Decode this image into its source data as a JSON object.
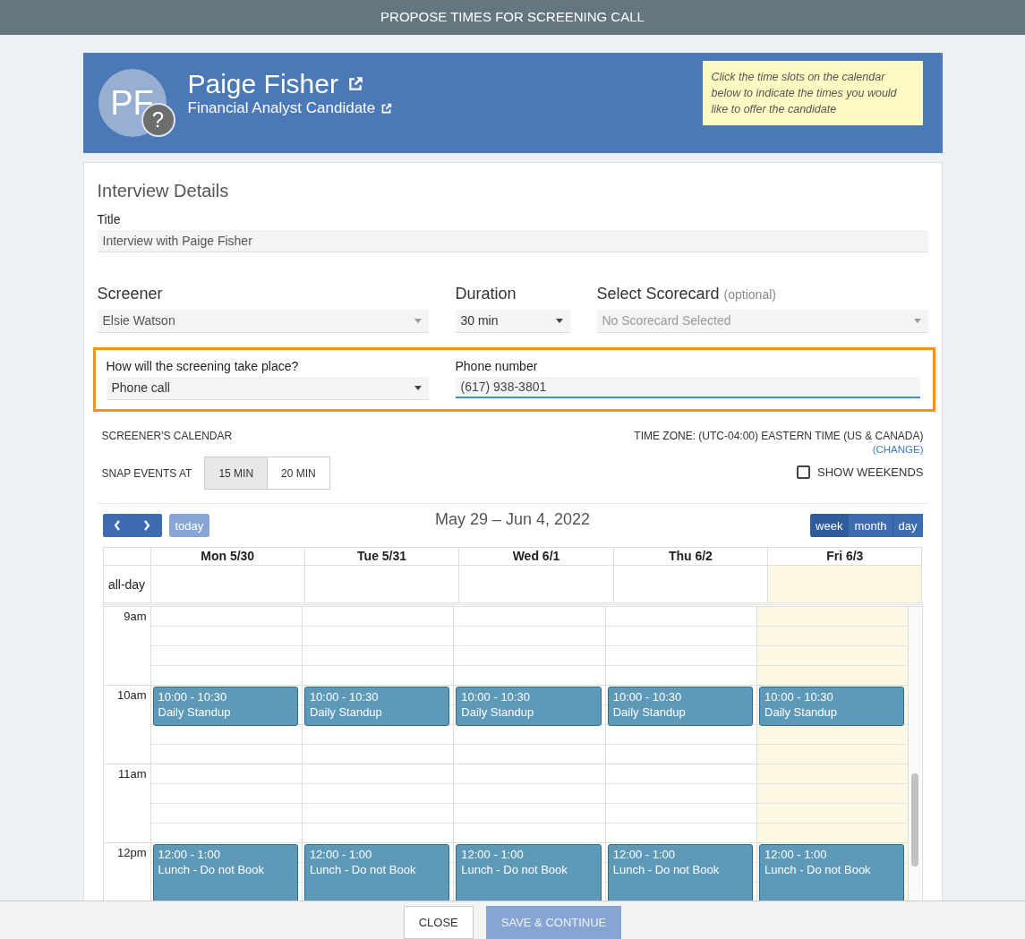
{
  "dialog": {
    "title": "PROPOSE TIMES FOR SCREENING CALL"
  },
  "candidate": {
    "initials": "PF",
    "badge": "?",
    "name": "Paige Fisher",
    "role": "Financial Analyst Candidate",
    "hint": "Click the time slots on the calendar below to indicate the times you would like to offer the candidate"
  },
  "details": {
    "heading": "Interview Details",
    "title_label": "Title",
    "title_value": "Interview with Paige Fisher",
    "screener": {
      "label": "Screener",
      "value": "Elsie Watson"
    },
    "duration": {
      "label": "Duration",
      "value": "30 min"
    },
    "scorecard": {
      "label": "Select Scorecard",
      "note": "(optional)",
      "placeholder": "No Scorecard Selected",
      "disabled": true
    },
    "method": {
      "label": "How will the screening take place?",
      "value": "Phone call"
    },
    "phone": {
      "label": "Phone number",
      "value": "(617) 938-3801"
    }
  },
  "calendar": {
    "label": "SCREENER'S CALENDAR",
    "timezone": "TIME ZONE: (UTC-04:00) EASTERN TIME (US & CANADA)",
    "change_link": "(CHANGE)",
    "snap_label": "SNAP EVENTS AT",
    "snap_options": [
      {
        "label": "15 MIN",
        "selected": true
      },
      {
        "label": "20 MIN",
        "selected": false
      }
    ],
    "show_weekends": {
      "label": "SHOW WEEKENDS",
      "checked": false
    },
    "range": "May 29 – Jun 4, 2022",
    "today_button": "today",
    "views": [
      {
        "label": "week",
        "selected": true
      },
      {
        "label": "month",
        "selected": false
      },
      {
        "label": "day",
        "selected": false
      }
    ],
    "all_day_label": "all-day",
    "days": [
      {
        "label": "Mon 5/30",
        "today": false
      },
      {
        "label": "Tue 5/31",
        "today": false
      },
      {
        "label": "Wed 6/1",
        "today": false
      },
      {
        "label": "Thu 6/2",
        "today": false
      },
      {
        "label": "Fri 6/3",
        "today": true
      }
    ],
    "hours": [
      {
        "label": "9am"
      },
      {
        "label": "10am",
        "events": [
          {
            "kind": "short",
            "time": "10:00 - 10:30",
            "title": "Daily Standup"
          },
          {
            "kind": "short",
            "time": "10:00 - 10:30",
            "title": "Daily Standup"
          },
          {
            "kind": "short",
            "time": "10:00 - 10:30",
            "title": "Daily Standup"
          },
          {
            "kind": "short",
            "time": "10:00 - 10:30",
            "title": "Daily Standup"
          },
          {
            "kind": "short",
            "time": "10:00 - 10:30",
            "title": "Daily Standup"
          }
        ]
      },
      {
        "label": "11am"
      },
      {
        "label": "12pm",
        "events": [
          {
            "kind": "long",
            "time": "12:00 - 1:00",
            "title": "Lunch - Do not Book"
          },
          {
            "kind": "long",
            "time": "12:00 - 1:00",
            "title": "Lunch - Do not Book"
          },
          {
            "kind": "long",
            "time": "12:00 - 1:00",
            "title": "Lunch - Do not Book"
          },
          {
            "kind": "long",
            "time": "12:00 - 1:00",
            "title": "Lunch - Do not Book"
          },
          {
            "kind": "long",
            "time": "12:00 - 1:00",
            "title": "Lunch - Do not Book"
          }
        ]
      }
    ]
  },
  "footer": {
    "close": "CLOSE",
    "save": {
      "label": "SAVE & CONTINUE",
      "disabled": true
    }
  }
}
